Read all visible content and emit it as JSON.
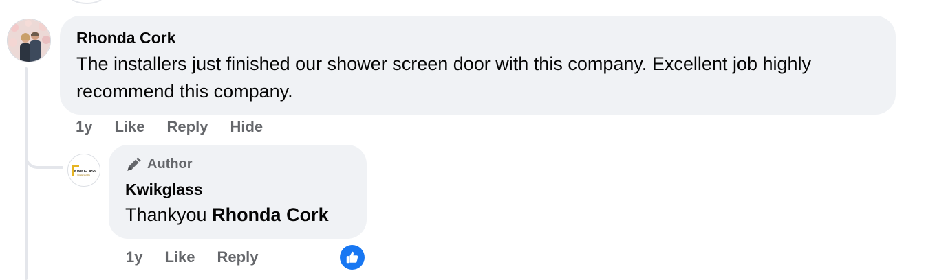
{
  "comment": {
    "author": "Rhonda Cork",
    "text": "The installers just finished our shower screen door with this company. Excellent job highly recommend this company.",
    "time": "1y",
    "actions": {
      "like": "Like",
      "reply": "Reply",
      "hide": "Hide"
    }
  },
  "reply": {
    "badge": "Author",
    "author": "Kwikglass",
    "text_prefix": "Thankyou ",
    "mention": "Rhonda Cork",
    "time": "1y",
    "actions": {
      "like": "Like",
      "reply": "Reply"
    },
    "logo_text": "KWIKGLASS",
    "logo_subtext": "GREENACRE",
    "reaction": "like-reaction-icon"
  },
  "colors": {
    "bubble": "#f0f2f5",
    "meta_text": "#65676b",
    "like_blue": "#1877f2",
    "thread_line": "#e4e6eb"
  }
}
